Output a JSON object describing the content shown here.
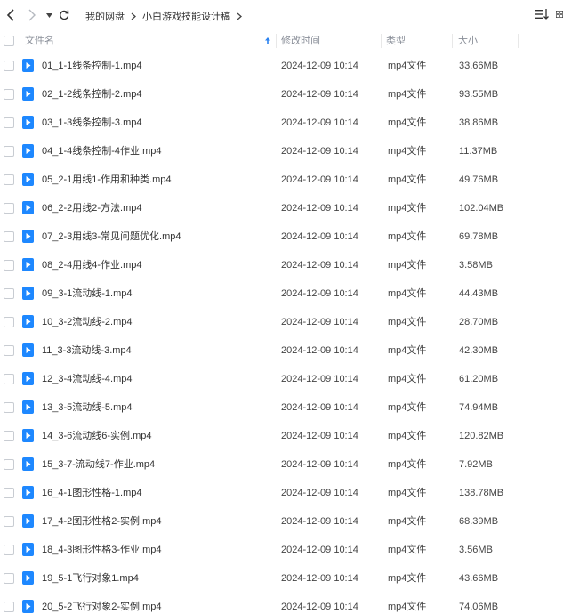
{
  "toolbar": {
    "breadcrumb": [
      "我的网盘",
      "小白游戏技能设计稿"
    ]
  },
  "table": {
    "columns": {
      "name": "文件名",
      "time": "修改时间",
      "type": "类型",
      "size": "大小"
    },
    "rows": [
      {
        "name": "01_1-1线条控制-1.mp4",
        "time": "2024-12-09 10:14",
        "type": "mp4文件",
        "size": "33.66MB"
      },
      {
        "name": "02_1-2线条控制-2.mp4",
        "time": "2024-12-09 10:14",
        "type": "mp4文件",
        "size": "93.55MB"
      },
      {
        "name": "03_1-3线条控制-3.mp4",
        "time": "2024-12-09 10:14",
        "type": "mp4文件",
        "size": "38.86MB"
      },
      {
        "name": "04_1-4线条控制-4作业.mp4",
        "time": "2024-12-09 10:14",
        "type": "mp4文件",
        "size": "11.37MB"
      },
      {
        "name": "05_2-1用线1-作用和种类.mp4",
        "time": "2024-12-09 10:14",
        "type": "mp4文件",
        "size": "49.76MB"
      },
      {
        "name": "06_2-2用线2-方法.mp4",
        "time": "2024-12-09 10:14",
        "type": "mp4文件",
        "size": "102.04MB"
      },
      {
        "name": "07_2-3用线3-常见问题优化.mp4",
        "time": "2024-12-09 10:14",
        "type": "mp4文件",
        "size": "69.78MB"
      },
      {
        "name": "08_2-4用线4-作业.mp4",
        "time": "2024-12-09 10:14",
        "type": "mp4文件",
        "size": "3.58MB"
      },
      {
        "name": "09_3-1流动线-1.mp4",
        "time": "2024-12-09 10:14",
        "type": "mp4文件",
        "size": "44.43MB"
      },
      {
        "name": "10_3-2流动线-2.mp4",
        "time": "2024-12-09 10:14",
        "type": "mp4文件",
        "size": "28.70MB"
      },
      {
        "name": "11_3-3流动线-3.mp4",
        "time": "2024-12-09 10:14",
        "type": "mp4文件",
        "size": "42.30MB"
      },
      {
        "name": "12_3-4流动线-4.mp4",
        "time": "2024-12-09 10:14",
        "type": "mp4文件",
        "size": "61.20MB"
      },
      {
        "name": "13_3-5流动线-5.mp4",
        "time": "2024-12-09 10:14",
        "type": "mp4文件",
        "size": "74.94MB"
      },
      {
        "name": "14_3-6流动线6-实例.mp4",
        "time": "2024-12-09 10:14",
        "type": "mp4文件",
        "size": "120.82MB"
      },
      {
        "name": "15_3-7-流动线7-作业.mp4",
        "time": "2024-12-09 10:14",
        "type": "mp4文件",
        "size": "7.92MB"
      },
      {
        "name": "16_4-1图形性格-1.mp4",
        "time": "2024-12-09 10:14",
        "type": "mp4文件",
        "size": "138.78MB"
      },
      {
        "name": "17_4-2图形性格2-实例.mp4",
        "time": "2024-12-09 10:14",
        "type": "mp4文件",
        "size": "68.39MB"
      },
      {
        "name": "18_4-3图形性格3-作业.mp4",
        "time": "2024-12-09 10:14",
        "type": "mp4文件",
        "size": "3.56MB"
      },
      {
        "name": "19_5-1飞行对象1.mp4",
        "time": "2024-12-09 10:14",
        "type": "mp4文件",
        "size": "43.66MB"
      },
      {
        "name": "20_5-2飞行对象2-实例.mp4",
        "time": "2024-12-09 10:14",
        "type": "mp4文件",
        "size": "74.06MB"
      }
    ]
  },
  "colors": {
    "file_icon": "#1e88ff",
    "header_text": "#8a8f99",
    "sort_arrow": "#2a82f0"
  },
  "icons": {
    "back": "back-icon",
    "forward": "forward-icon",
    "dropdown": "chevron-down-icon",
    "refresh": "refresh-icon",
    "sort": "sort-icon",
    "grid_view": "grid-view-icon",
    "sort_arrow": "sort-arrow-up-icon",
    "file": "video-file-icon"
  }
}
